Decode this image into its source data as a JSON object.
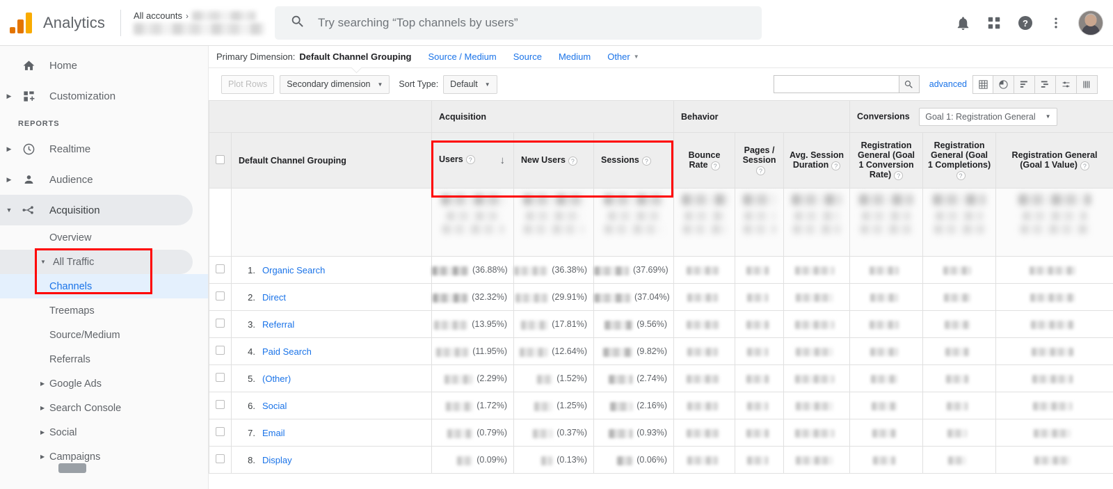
{
  "header": {
    "brand": "Analytics",
    "account_label": "All accounts",
    "account_chevron": "›",
    "search_placeholder": "Try searching “Top channels by users”",
    "icons": [
      "notifications-bell-icon",
      "apps-grid-icon",
      "help-icon",
      "more-vert-icon",
      "user-avatar"
    ]
  },
  "sidebar": {
    "items": [
      {
        "label": "Home",
        "icon": "home-icon",
        "expandable": false
      },
      {
        "label": "Customization",
        "icon": "customization-icon",
        "expandable": true
      }
    ],
    "section_label": "REPORTS",
    "reports": [
      {
        "label": "Realtime",
        "icon": "clock-icon",
        "expandable": true
      },
      {
        "label": "Audience",
        "icon": "person-icon",
        "expandable": true
      },
      {
        "label": "Acquisition",
        "icon": "acquisition-icon",
        "expandable": true,
        "active": true
      }
    ],
    "acquisition_children": [
      {
        "label": "Overview",
        "expandable": false,
        "selected": false
      },
      {
        "label": "All Traffic",
        "expandable": true,
        "open": true,
        "selected": false
      },
      {
        "label": "Channels",
        "expandable": false,
        "selected": true,
        "child": true
      },
      {
        "label": "Treemaps",
        "expandable": false,
        "selected": false,
        "child": true
      },
      {
        "label": "Source/Medium",
        "expandable": false,
        "selected": false,
        "child": true
      },
      {
        "label": "Referrals",
        "expandable": false,
        "selected": false,
        "child": true
      },
      {
        "label": "Google Ads",
        "expandable": true,
        "selected": false
      },
      {
        "label": "Search Console",
        "expandable": true,
        "selected": false
      },
      {
        "label": "Social",
        "expandable": true,
        "selected": false
      },
      {
        "label": "Campaigns",
        "expandable": true,
        "selected": false
      }
    ]
  },
  "dimension_bar": {
    "label": "Primary Dimension:",
    "current": "Default Channel Grouping",
    "links": [
      "Source / Medium",
      "Source",
      "Medium"
    ],
    "other": "Other"
  },
  "controls": {
    "plot_rows": "Plot Rows",
    "secondary_dimension": "Secondary dimension",
    "sort_type_label": "Sort Type:",
    "sort_type_value": "Default",
    "find_value": "",
    "advanced": "advanced",
    "view_icons": [
      "table-view-icon",
      "pie-view-icon",
      "bar-view-icon",
      "performance-view-icon",
      "comparison-view-icon",
      "pivot-view-icon"
    ]
  },
  "table": {
    "groups": [
      {
        "label": "Acquisition",
        "span": 3
      },
      {
        "label": "Behavior",
        "span": 3
      },
      {
        "label": "Conversions",
        "span": 3,
        "goal_selector": "Goal 1: Registration General"
      }
    ],
    "dimension_header": "Default Channel Grouping",
    "columns": [
      {
        "label": "Users",
        "help": true,
        "sorted": true,
        "sort_dir": "↓"
      },
      {
        "label": "New Users",
        "help": true
      },
      {
        "label": "Sessions",
        "help": true
      },
      {
        "label": "Bounce Rate",
        "help": true
      },
      {
        "label": "Pages / Session",
        "help": true
      },
      {
        "label": "Avg. Session Duration",
        "help": true
      },
      {
        "label": "Registration General (Goal 1 Conversion Rate)",
        "help": true
      },
      {
        "label": "Registration General (Goal 1 Completions)",
        "help": true
      },
      {
        "label": "Registration General (Goal 1 Value)",
        "help": true
      }
    ],
    "rows": [
      {
        "num": "1.",
        "name": "Organic Search",
        "users_pct": "(36.88%)",
        "new_users_pct": "(36.38%)",
        "sessions_pct": "(37.69%)"
      },
      {
        "num": "2.",
        "name": "Direct",
        "users_pct": "(32.32%)",
        "new_users_pct": "(29.91%)",
        "sessions_pct": "(37.04%)"
      },
      {
        "num": "3.",
        "name": "Referral",
        "users_pct": "(13.95%)",
        "new_users_pct": "(17.81%)",
        "sessions_pct": "(9.56%)"
      },
      {
        "num": "4.",
        "name": "Paid Search",
        "users_pct": "(11.95%)",
        "new_users_pct": "(12.64%)",
        "sessions_pct": "(9.82%)"
      },
      {
        "num": "5.",
        "name": "(Other)",
        "users_pct": "(2.29%)",
        "new_users_pct": "(1.52%)",
        "sessions_pct": "(2.74%)"
      },
      {
        "num": "6.",
        "name": "Social",
        "users_pct": "(1.72%)",
        "new_users_pct": "(1.25%)",
        "sessions_pct": "(2.16%)"
      },
      {
        "num": "7.",
        "name": "Email",
        "users_pct": "(0.79%)",
        "new_users_pct": "(0.37%)",
        "sessions_pct": "(0.93%)"
      },
      {
        "num": "8.",
        "name": "Display",
        "users_pct": "(0.09%)",
        "new_users_pct": "(0.13%)",
        "sessions_pct": "(0.06%)"
      }
    ]
  },
  "annotations": {
    "accent_color": "#ff0000",
    "boxes": [
      "sidebar-all-traffic-channels",
      "acquisition-metric-headers"
    ]
  }
}
